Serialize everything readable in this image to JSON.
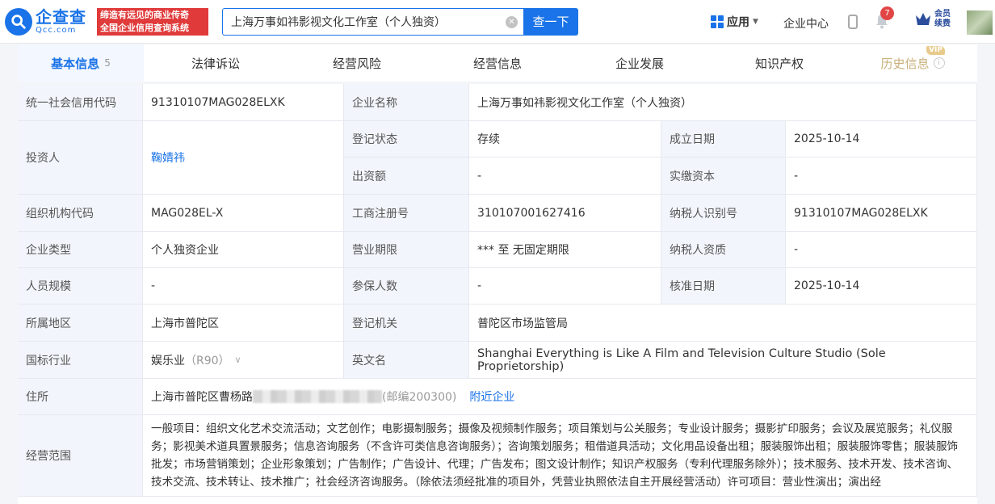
{
  "header": {
    "logo_cn": "企查查",
    "logo_en": "Qcc.com",
    "slogan_line1": "缔造有远见的商业传奇",
    "slogan_line2": "全国企业信用查询系统",
    "search_value": "上海万事如祎影视文化工作室（个人独资）",
    "search_button": "查一下",
    "nav_app": "应用",
    "nav_center": "企业中心",
    "notification_count": "7",
    "vip_line1": "会员",
    "vip_line2": "续费",
    "colors": {
      "brand": "#1a73e8",
      "slogan_bg": "#e03a3a",
      "badge": "#e24545"
    }
  },
  "tabs": [
    {
      "label": "基本信息",
      "count": "5"
    },
    {
      "label": "法律诉讼"
    },
    {
      "label": "经营风险"
    },
    {
      "label": "经营信息"
    },
    {
      "label": "企业发展"
    },
    {
      "label": "知识产权"
    },
    {
      "label": "历史信息",
      "tag": "VIP"
    }
  ],
  "info": {
    "credit_code_label": "统一社会信用代码",
    "credit_code": "91310107MAG028ELXK",
    "company_name_label": "企业名称",
    "company_name": "上海万事如祎影视文化工作室（个人独资）",
    "investor_label": "投资人",
    "investor": "鞠婧祎",
    "reg_status_label": "登记状态",
    "reg_status": "存续",
    "found_date_label": "成立日期",
    "found_date": "2025-10-14",
    "contribution_label": "出资额",
    "contribution": "-",
    "paid_capital_label": "实缴资本",
    "paid_capital": "-",
    "org_code_label": "组织机构代码",
    "org_code": "MAG028EL-X",
    "biz_reg_no_label": "工商注册号",
    "biz_reg_no": "310107001627416",
    "taxpayer_id_label": "纳税人识别号",
    "taxpayer_id": "91310107MAG028ELXK",
    "company_type_label": "企业类型",
    "company_type": "个人独资企业",
    "term_label": "营业期限",
    "term": "*** 至 无固定期限",
    "taxpayer_qual_label": "纳税人资质",
    "taxpayer_qual": "-",
    "staff_size_label": "人员规模",
    "staff_size": "-",
    "insured_label": "参保人数",
    "insured": "-",
    "approve_date_label": "核准日期",
    "approve_date": "2025-10-14",
    "region_label": "所属地区",
    "region": "上海市普陀区",
    "reg_authority_label": "登记机关",
    "reg_authority": "普陀区市场监管局",
    "industry_label": "国标行业",
    "industry": "娱乐业",
    "industry_code": "（R90）",
    "english_name_label": "英文名",
    "english_name": "Shanghai Everything is Like A Film and Television Culture Studio (Sole Proprietorship)",
    "address_label": "住所",
    "address_prefix": "上海市普陀区曹杨路",
    "postal": "(邮编200300)",
    "nearby_link": "附近企业",
    "scope_label": "经营范围",
    "scope": "一般项目：组织文化艺术交流活动；文艺创作；电影摄制服务；摄像及视频制作服务；项目策划与公关服务；专业设计服务；摄影扩印服务；会议及展览服务；礼仪服务；影视美术道具置景服务；信息咨询服务（不含许可类信息咨询服务）；咨询策划服务；租借道具活动；文化用品设备出租；服装服饰出租；服装服饰零售；服装服饰批发；市场营销策划；企业形象策划；广告制作；广告设计、代理；广告发布；图文设计制作；知识产权服务（专利代理服务除外）；技术服务、技术开发、技术咨询、技术交流、技术转让、技术推广；社会经济咨询服务。（除依法须经批准的项目外，凭营业执照依法自主开展经营活动）许可项目：营业性演出；演出经"
  }
}
